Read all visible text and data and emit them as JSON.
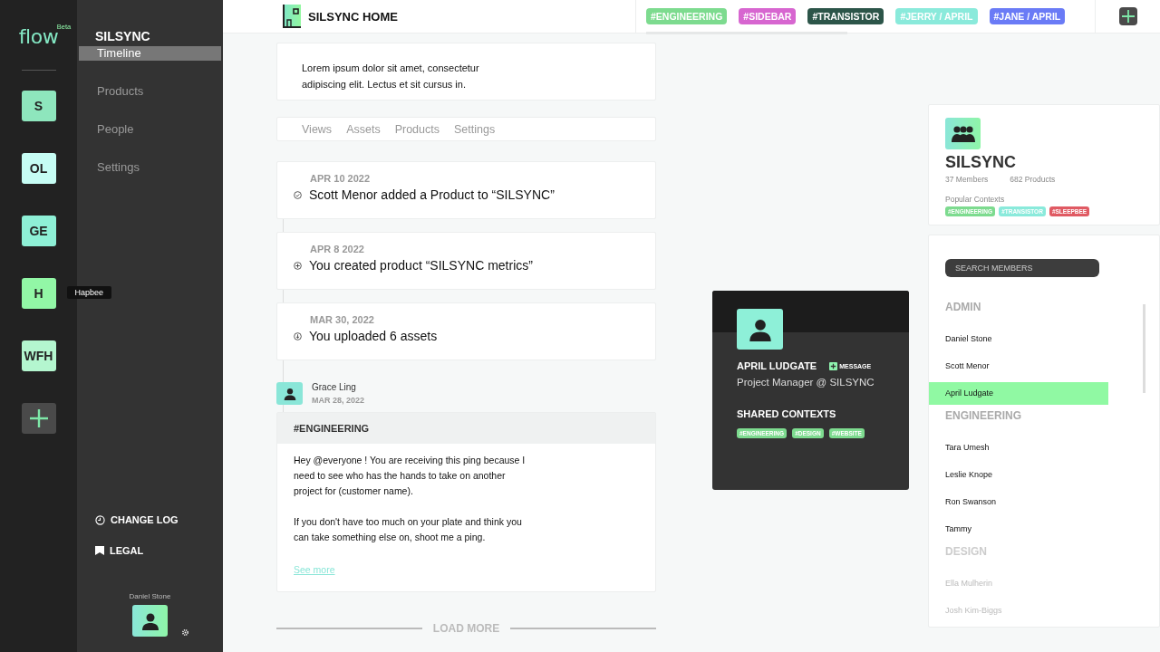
{
  "rail": {
    "logo": "flow",
    "logo_badge": "Beta",
    "workspaces": [
      {
        "label": "S",
        "color": "#8ee6bd"
      },
      {
        "label": "OL",
        "color": "#c6fdf4"
      },
      {
        "label": "GE",
        "color": "#8ef0d6"
      },
      {
        "label": "H",
        "color": "#92f7a6",
        "tooltip": "Hapbee"
      },
      {
        "label": "WFH",
        "color": "#b4f6cf"
      }
    ]
  },
  "nav": {
    "title": "SILSYNC",
    "items": [
      {
        "label": "Timeline",
        "selected": true
      },
      {
        "label": "Products",
        "selected": false
      },
      {
        "label": "People",
        "selected": false
      },
      {
        "label": "Settings",
        "selected": false
      }
    ],
    "links": [
      {
        "kind": "clock",
        "label": "CHANGE LOG"
      },
      {
        "kind": "flag",
        "label": "LEGAL"
      }
    ],
    "user": "Daniel Stone"
  },
  "header": {
    "title": "SILSYNC HOME",
    "tags": [
      {
        "label": "#ENGINEERING",
        "color": "#7ddb8f"
      },
      {
        "label": "#SIDEBAR",
        "color": "#d766d0"
      },
      {
        "label": "#TRANSISTOR",
        "color": "#2c5549"
      },
      {
        "label": "#JERRY / APRIL",
        "color": "#8aeadb"
      },
      {
        "label": "#JANE / APRIL",
        "color": "#6a7bf6"
      }
    ]
  },
  "intro": "Lorem ipsum dolor sit amet, consectetur adipiscing elit. Lectus et sit cursus in.",
  "tabs": [
    {
      "label": "Views",
      "selected": false
    },
    {
      "label": "Assets",
      "selected": false
    },
    {
      "label": "Products",
      "selected": false
    },
    {
      "label": "Settings",
      "selected": false
    }
  ],
  "events": [
    {
      "kind": "check",
      "date": "APR 10 2022",
      "text": "Scott Menor added a Product to “SILSYNC”"
    },
    {
      "kind": "add",
      "date": "APR 8 2022",
      "text": "You created product “SILSYNC metrics”"
    },
    {
      "kind": "download",
      "date": "MAR 30, 2022",
      "text": "You uploaded 6 assets"
    }
  ],
  "post": {
    "author": "Grace Ling",
    "date": "MAR 28, 2022",
    "context": "#ENGINEERING",
    "paragraphs": [
      "Hey @everyone ! You are receiving this ping because I need to see who has the hands to take on another project for (customer name).",
      "If you don't have too much on your plate and think you can take something else on, shoot me a ping."
    ],
    "link": "See more"
  },
  "load_more": "LOAD MORE",
  "profile": {
    "name": "APRIL LUDGATE",
    "action": "MESSAGE",
    "role": "Project Manager @ SILSYNC",
    "contexts_title": "SHARED CONTEXTS",
    "contexts": [
      "#ENGINEERING",
      "#DESIGN",
      "#WEBSITE"
    ]
  },
  "group": {
    "name": "SILSYNC",
    "members": "37 Members",
    "products": "682 Products",
    "contexts_title": "Popular Contexts",
    "contexts": [
      {
        "label": "#ENGINEERING",
        "color": "#7ddb8f"
      },
      {
        "label": "#TRANSISTOR",
        "color": "#8aeadb"
      },
      {
        "label": "#SLEEPBEE",
        "color": "#e05a63"
      }
    ]
  },
  "members": {
    "placeholder": "SEARCH MEMBERS",
    "groups": [
      {
        "title": "ADMIN",
        "dimmed": false,
        "people": [
          {
            "name": "Daniel Stone",
            "selected": false
          },
          {
            "name": "Scott Menor",
            "selected": false
          },
          {
            "name": "April Ludgate",
            "selected": true
          }
        ]
      },
      {
        "title": "ENGINEERING",
        "dimmed": false,
        "people": [
          {
            "name": "Tara Umesh",
            "selected": false
          },
          {
            "name": "Leslie Knope",
            "selected": false
          },
          {
            "name": "Ron Swanson",
            "selected": false
          },
          {
            "name": "Tammy",
            "selected": false
          }
        ]
      },
      {
        "title": "DESIGN",
        "dimmed": true,
        "people": [
          {
            "name": "Ella Mulherin",
            "selected": false
          },
          {
            "name": "Josh Kim-Biggs",
            "selected": false
          }
        ]
      }
    ]
  }
}
